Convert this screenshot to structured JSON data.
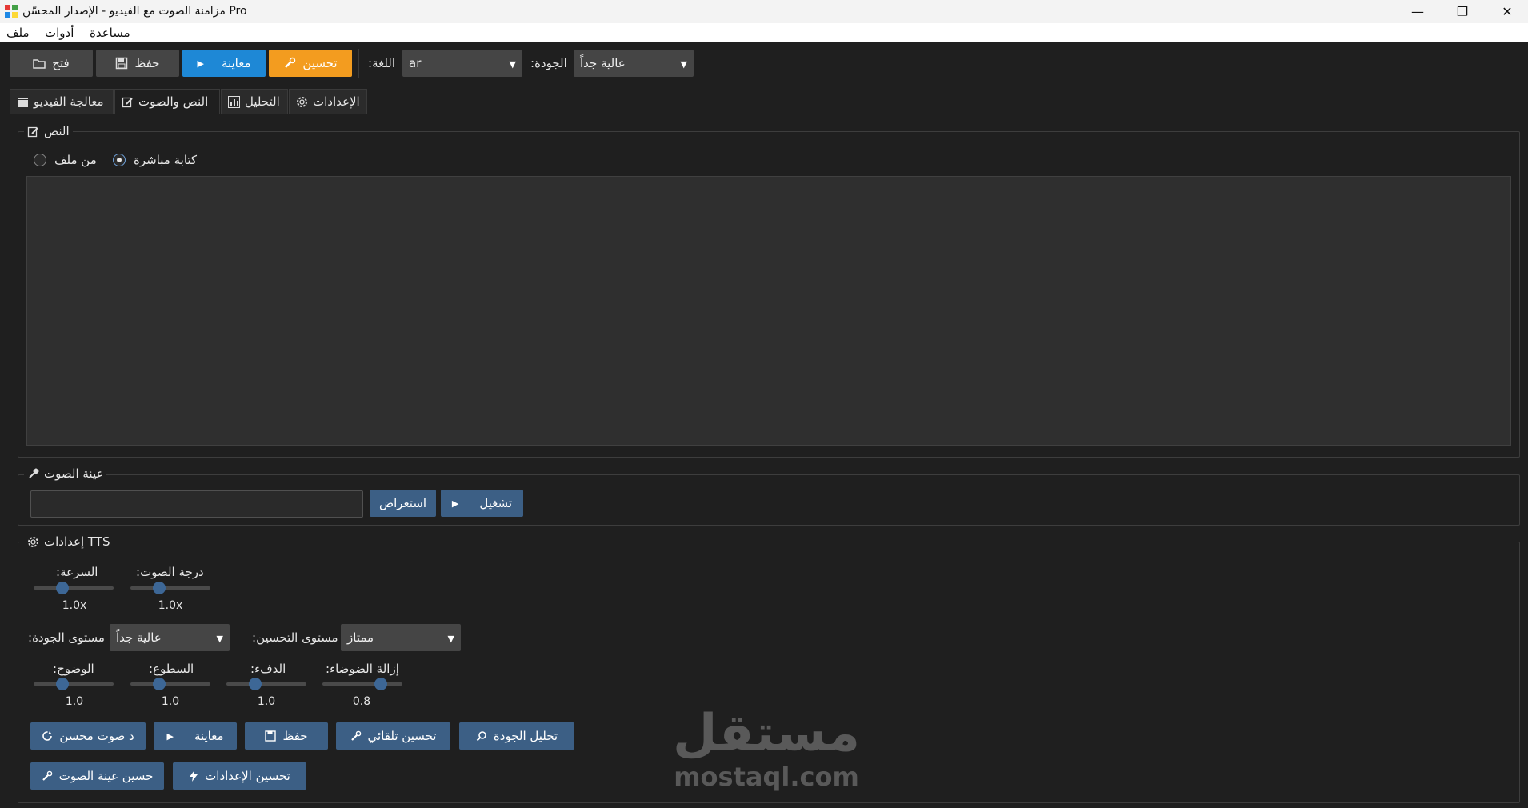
{
  "window": {
    "title": "مزامنة الصوت مع الفيديو - الإصدار المحسّن Pro"
  },
  "menu": {
    "file": "ملف",
    "tools": "أدوات",
    "help": "مساعدة"
  },
  "toolbar": {
    "open_label": "فتح",
    "save_label": "حفظ",
    "preview_label": "معاينة",
    "enhance_label": "تحسين",
    "language_label": ":اللغة",
    "language_value": "ar",
    "quality_label": ":الجودة",
    "quality_value": "عالية جداً"
  },
  "tabs": [
    {
      "label": "معالجة الفيديو",
      "icon": "clapperboard-icon"
    },
    {
      "label": "النص والصوت",
      "icon": "edit-icon"
    },
    {
      "label": "التحليل",
      "icon": "bar-chart-icon"
    },
    {
      "label": "الإعدادات",
      "icon": "gear-icon"
    }
  ],
  "text_group": {
    "title": "النص",
    "radio_direct": "كتابة مباشرة",
    "radio_file": "من ملف",
    "selected": "direct"
  },
  "voice_sample": {
    "title": "عينة الصوت",
    "path_value": "",
    "browse_label": "استعراض",
    "play_label": "تشغيل"
  },
  "tts": {
    "title": "إعدادات TTS",
    "speed_label": ":السرعة",
    "speed_value": "1.0x",
    "pitch_label": ":درجة الصوت",
    "pitch_value": "1.0x",
    "quality_level_label": ":مستوى الجودة",
    "quality_level_value": "عالية جداً",
    "enhance_level_label": ":مستوى التحسين",
    "enhance_level_value": "ممتاز",
    "clarity_label": ":الوضوح",
    "clarity_value": "1.0",
    "brightness_label": ":السطوع",
    "brightness_value": "1.0",
    "warmth_label": ":الدفء",
    "warmth_value": "1.0",
    "denoise_label": ":إزالة الضوضاء",
    "denoise_value": "0.8",
    "gen_enhanced_label": "د صوت محسن",
    "preview_label": "معاينة",
    "save_label": "حفظ",
    "auto_enhance_label": "تحسين تلقائي",
    "quality_analysis_label": "تحليل الجودة",
    "enhance_sample_label": "حسين عينة الصوت",
    "enhance_settings_label": "تحسين الإعدادات"
  },
  "watermark": {
    "arabic": "مستقل",
    "latin": "mostaql.com"
  }
}
